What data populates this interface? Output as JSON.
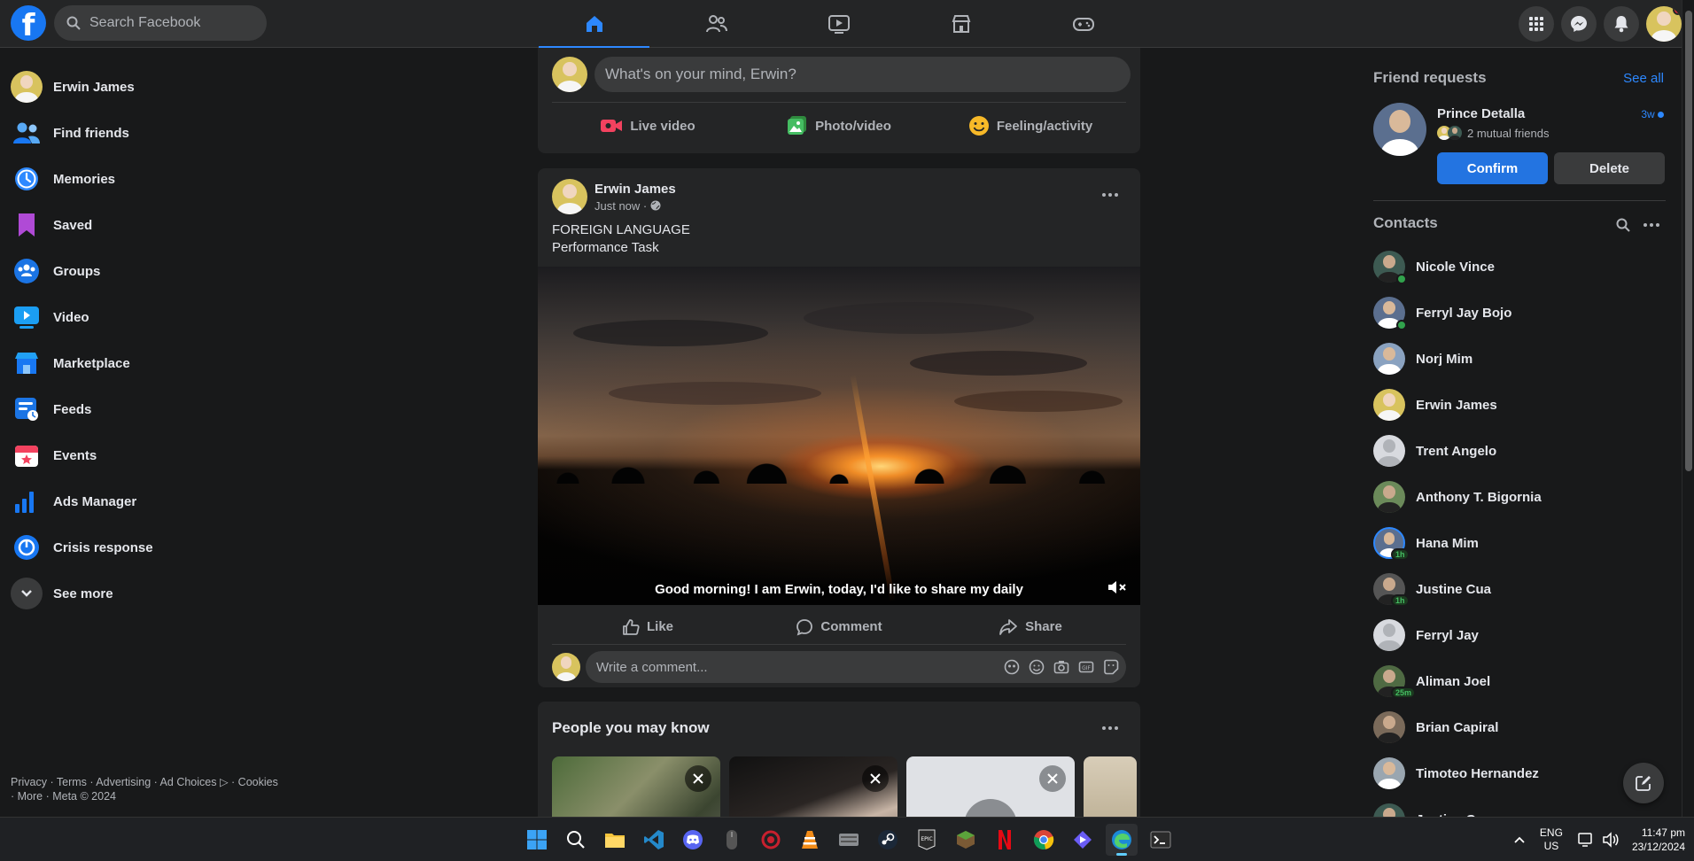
{
  "topbar": {
    "logo": "f",
    "search_placeholder": "Search Facebook",
    "tabs": [
      "home-icon",
      "friends-icon",
      "watch-icon",
      "marketplace-icon",
      "gaming-icon"
    ],
    "right_icons": [
      "menu-grid-icon",
      "messenger-icon",
      "notifications-icon"
    ]
  },
  "sidebar": {
    "items": [
      {
        "label": "Erwin James",
        "icon": "profile-avatar"
      },
      {
        "label": "Find friends",
        "icon": "friends-icon"
      },
      {
        "label": "Memories",
        "icon": "clock-icon"
      },
      {
        "label": "Saved",
        "icon": "bookmark-icon"
      },
      {
        "label": "Groups",
        "icon": "groups-icon"
      },
      {
        "label": "Video",
        "icon": "video-icon"
      },
      {
        "label": "Marketplace",
        "icon": "shop-icon"
      },
      {
        "label": "Feeds",
        "icon": "feeds-icon"
      },
      {
        "label": "Events",
        "icon": "calendar-icon"
      },
      {
        "label": "Ads Manager",
        "icon": "bar-chart-icon"
      },
      {
        "label": "Crisis response",
        "icon": "crisis-icon"
      },
      {
        "label": "See more",
        "icon": "chevron-down-icon"
      }
    ],
    "footer_line1": "Privacy · Terms · Advertising · Ad Choices ▷ · Cookies",
    "footer_line2": "· More · Meta © 2024"
  },
  "composer": {
    "placeholder": "What's on your mind, Erwin?",
    "live": "Live video",
    "photo": "Photo/video",
    "feeling": "Feeling/activity"
  },
  "post": {
    "author": "Erwin James",
    "time": "Just now ·",
    "text_line1": "FOREIGN LANGUAGE",
    "text_line2": "Performance Task",
    "caption": "Good morning! I am Erwin, today, I'd like to share my daily",
    "like": "Like",
    "comment": "Comment",
    "share": "Share",
    "comment_placeholder": "Write a comment..."
  },
  "pymk": {
    "title": "People you may know"
  },
  "friend_requests": {
    "title": "Friend requests",
    "see_all": "See all",
    "name": "Prince Detalla",
    "time": "3w",
    "mutual": "2 mutual friends",
    "confirm": "Confirm",
    "delete": "Delete"
  },
  "contacts": {
    "title": "Contacts",
    "list": [
      {
        "name": "Nicole Vince",
        "status": "online"
      },
      {
        "name": "Ferryl Jay Bojo",
        "status": "online"
      },
      {
        "name": "Norj Mim",
        "status": ""
      },
      {
        "name": "Erwin James",
        "status": ""
      },
      {
        "name": "Trent Angelo",
        "status": ""
      },
      {
        "name": "Anthony T. Bigornia",
        "status": ""
      },
      {
        "name": "Hana Mim",
        "status": "1h"
      },
      {
        "name": "Justine Cua",
        "status": "1h"
      },
      {
        "name": "Ferryl Jay",
        "status": ""
      },
      {
        "name": "Aliman Joel",
        "status": "25m"
      },
      {
        "name": "Brian Capiral",
        "status": ""
      },
      {
        "name": "Timoteo Hernandez",
        "status": ""
      },
      {
        "name": "Justine Cua",
        "status": ""
      }
    ]
  },
  "taskbar": {
    "lang_line1": "ENG",
    "lang_line2": "US",
    "time": "11:47 pm",
    "date": "23/12/2024"
  }
}
